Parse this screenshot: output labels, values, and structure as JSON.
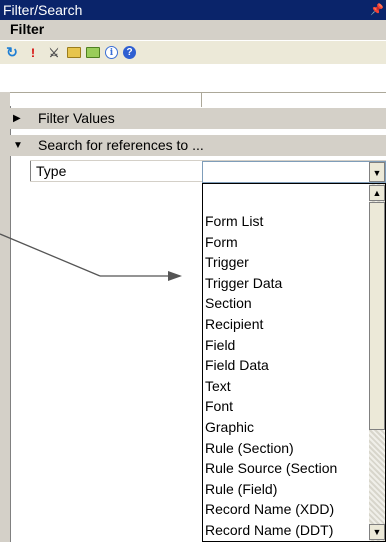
{
  "window": {
    "title": "Filter/Search",
    "pin_icon": "pushpin-icon"
  },
  "panel": {
    "header": "Filter"
  },
  "toolbar": {
    "icons": [
      "refresh-icon",
      "exclamation-icon",
      "binoculars-icon",
      "folder-icon",
      "folder-green-icon",
      "info-icon",
      "help-icon"
    ]
  },
  "categories": {
    "filter_values": "Filter Values",
    "search_refs": "Search for references to ..."
  },
  "property": {
    "name": "Type",
    "value": ""
  },
  "dropdown": {
    "options": [
      "",
      "Form List",
      "Form",
      "Trigger",
      "Trigger Data",
      "Section",
      "Recipient",
      "Field",
      "Field Data",
      "Text",
      "Font",
      "Graphic",
      "Rule (Section)",
      "Rule Source (Section",
      "Rule (Field)",
      "Record Name (XDD)",
      "Record Name (DDT)"
    ]
  },
  "colors": {
    "title_bar": "#0a246a",
    "panel_bg": "#d4d0c8",
    "toolbar_bg": "#ece9d8"
  }
}
